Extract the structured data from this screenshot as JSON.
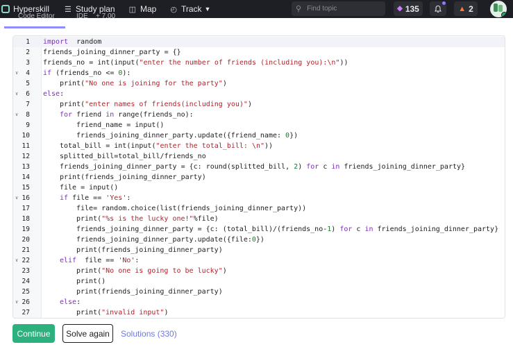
{
  "nav": {
    "brand": "Hyperskill",
    "study_plan": "Study plan",
    "map": "Map",
    "track": "Track",
    "search_placeholder": "Find topic",
    "gems_count": "135",
    "streak_count": "2",
    "icons": {
      "study_plan": "list-icon",
      "map": "map-icon",
      "track": "track-icon",
      "search": "search-icon",
      "gem": "gem-icon",
      "bell": "bell-icon",
      "fire": "fire-icon"
    }
  },
  "tabs": {
    "code_editor": "Code Editor",
    "ide": "IDE",
    "ide_badge": "+ 7.00"
  },
  "editor": {
    "lines": [
      {
        "n": "1",
        "fold": false,
        "indent": 0,
        "tokens": [
          [
            "kw",
            "import"
          ],
          [
            "",
            "  random"
          ]
        ]
      },
      {
        "n": "2",
        "fold": false,
        "indent": 0,
        "tokens": [
          [
            "",
            "friends_joining_dinner_party = {}"
          ]
        ]
      },
      {
        "n": "3",
        "fold": false,
        "indent": 0,
        "tokens": [
          [
            "",
            "friends_no = int(input("
          ],
          [
            "str",
            "\"enter the number of friends (including you):\\n\""
          ],
          [
            "",
            "))"
          ]
        ]
      },
      {
        "n": "4",
        "fold": true,
        "indent": 0,
        "tokens": [
          [
            "kw",
            "if"
          ],
          [
            "",
            " (friends_no <= "
          ],
          [
            "num",
            "0"
          ],
          [
            "",
            "):"
          ]
        ]
      },
      {
        "n": "5",
        "fold": false,
        "indent": 1,
        "tokens": [
          [
            "",
            "print("
          ],
          [
            "str",
            "\"No one is joining for the party\""
          ],
          [
            "",
            ")"
          ]
        ]
      },
      {
        "n": "6",
        "fold": true,
        "indent": 0,
        "tokens": [
          [
            "kw",
            "else"
          ],
          [
            "",
            ":"
          ]
        ]
      },
      {
        "n": "7",
        "fold": false,
        "indent": 1,
        "tokens": [
          [
            "",
            "print("
          ],
          [
            "str",
            "\"enter names of friends(including you)\""
          ],
          [
            "",
            ")"
          ]
        ]
      },
      {
        "n": "8",
        "fold": true,
        "indent": 1,
        "tokens": [
          [
            "kw",
            "for"
          ],
          [
            "",
            " friend "
          ],
          [
            "kw",
            "in"
          ],
          [
            "",
            " range(friends_no):"
          ]
        ]
      },
      {
        "n": "9",
        "fold": false,
        "indent": 2,
        "tokens": [
          [
            "",
            "friend_name = input()"
          ]
        ]
      },
      {
        "n": "10",
        "fold": false,
        "indent": 2,
        "tokens": [
          [
            "",
            "friends_joining_dinner_party.update({friend_name: "
          ],
          [
            "num",
            "0"
          ],
          [
            "",
            "})"
          ]
        ]
      },
      {
        "n": "11",
        "fold": false,
        "indent": 1,
        "tokens": [
          [
            "",
            "total_bill = int(input("
          ],
          [
            "str",
            "\"enter the total_bill: \\n\""
          ],
          [
            "",
            "))"
          ]
        ]
      },
      {
        "n": "12",
        "fold": false,
        "indent": 1,
        "tokens": [
          [
            "",
            "splitted_bill=total_bill/friends_no"
          ]
        ]
      },
      {
        "n": "13",
        "fold": false,
        "indent": 1,
        "tokens": [
          [
            "",
            "friends_joining_dinner_party = {c: round(splitted_bill, "
          ],
          [
            "num",
            "2"
          ],
          [
            "",
            ") "
          ],
          [
            "kw",
            "for"
          ],
          [
            "",
            " c "
          ],
          [
            "kw",
            "in"
          ],
          [
            "",
            " friends_joining_dinner_party}"
          ]
        ]
      },
      {
        "n": "14",
        "fold": false,
        "indent": 1,
        "tokens": [
          [
            "",
            "print(friends_joining_dinner_party)"
          ]
        ]
      },
      {
        "n": "15",
        "fold": false,
        "indent": 1,
        "tokens": [
          [
            "",
            "file = input()"
          ]
        ]
      },
      {
        "n": "16",
        "fold": true,
        "indent": 1,
        "tokens": [
          [
            "kw",
            "if"
          ],
          [
            "",
            " file == "
          ],
          [
            "str",
            "'Yes'"
          ],
          [
            "",
            ":"
          ]
        ]
      },
      {
        "n": "17",
        "fold": false,
        "indent": 2,
        "tokens": [
          [
            "",
            "file= random.choice(list(friends_joining_dinner_party))"
          ]
        ]
      },
      {
        "n": "18",
        "fold": false,
        "indent": 2,
        "tokens": [
          [
            "",
            "print("
          ],
          [
            "str",
            "\"%s is the lucky one!\""
          ],
          [
            "",
            "%file)"
          ]
        ]
      },
      {
        "n": "19",
        "fold": false,
        "indent": 2,
        "tokens": [
          [
            "",
            "friends_joining_dinner_party = {c: (total_bill)/(friends_no-"
          ],
          [
            "num",
            "1"
          ],
          [
            "",
            ") "
          ],
          [
            "kw",
            "for"
          ],
          [
            "",
            " c "
          ],
          [
            "kw",
            "in"
          ],
          [
            "",
            " friends_joining_dinner_party}"
          ]
        ]
      },
      {
        "n": "20",
        "fold": false,
        "indent": 2,
        "tokens": [
          [
            "",
            "friends_joining_dinner_party.update({file:"
          ],
          [
            "num",
            "0"
          ],
          [
            "",
            "})"
          ]
        ]
      },
      {
        "n": "21",
        "fold": false,
        "indent": 2,
        "tokens": [
          [
            "",
            "print(friends_joining_dinner_party)"
          ]
        ]
      },
      {
        "n": "22",
        "fold": true,
        "indent": 1,
        "tokens": [
          [
            "kw",
            "elif"
          ],
          [
            "",
            "  file == "
          ],
          [
            "str",
            "'No'"
          ],
          [
            "",
            ":"
          ]
        ]
      },
      {
        "n": "23",
        "fold": false,
        "indent": 2,
        "tokens": [
          [
            "",
            "print("
          ],
          [
            "str",
            "\"No one is going to be lucky\""
          ],
          [
            "",
            ")"
          ]
        ]
      },
      {
        "n": "24",
        "fold": false,
        "indent": 2,
        "tokens": [
          [
            "",
            "print()"
          ]
        ]
      },
      {
        "n": "25",
        "fold": false,
        "indent": 2,
        "tokens": [
          [
            "",
            "print(friends_joining_dinner_party)"
          ]
        ]
      },
      {
        "n": "26",
        "fold": true,
        "indent": 1,
        "tokens": [
          [
            "kw",
            "else"
          ],
          [
            "",
            ":"
          ]
        ]
      },
      {
        "n": "27",
        "fold": false,
        "indent": 2,
        "tokens": [
          [
            "",
            "print("
          ],
          [
            "str",
            "\"invalid input\""
          ],
          [
            "",
            ")"
          ]
        ]
      }
    ]
  },
  "actions": {
    "continue": "Continue",
    "solve_again": "Solve again",
    "solutions": "Solutions (330)"
  }
}
